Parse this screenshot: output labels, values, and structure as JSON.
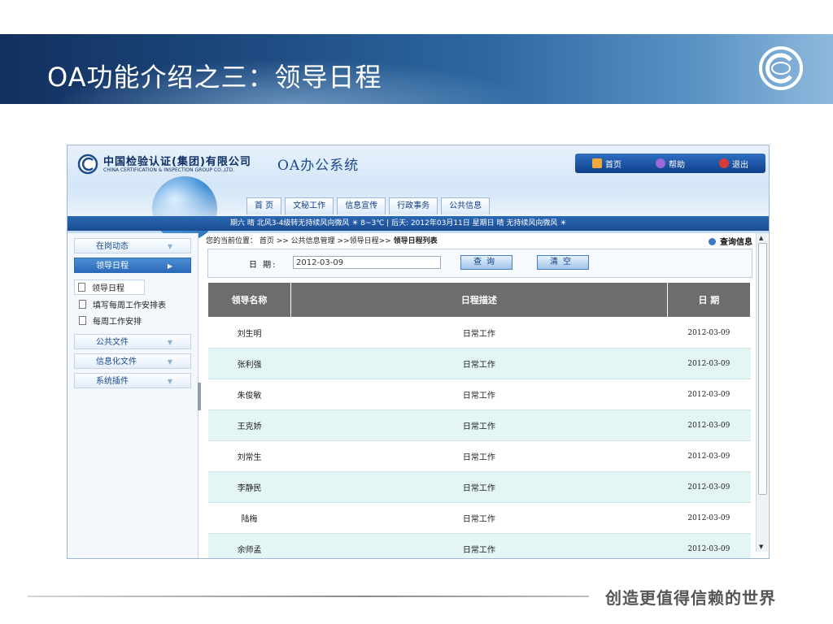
{
  "slide": {
    "title": "OA功能介绍之三：领导日程",
    "slogan": "创造更值得信赖的世界"
  },
  "app": {
    "company_cn": "中国检验认证(集团)有限公司",
    "company_en": "CHINA CERTIFICATION & INSPECTION GROUP CO.,LTD.",
    "system_name": "OA办公系统",
    "topnav": [
      {
        "label": "首页",
        "icon": "home-icon"
      },
      {
        "label": "帮助",
        "icon": "help-icon"
      },
      {
        "label": "退出",
        "icon": "exit-icon"
      }
    ],
    "tabs": [
      "首 页",
      "文秘工作",
      "信息宣传",
      "行政事务",
      "公共信息"
    ],
    "weather": "期六 晴 北风3-4级转无持续风向微风 ☀ 8~3℃ | 后天: 2012年03月11日 星期日 晴 无持续风向微风 ☀"
  },
  "sidebar": {
    "menu": [
      "在岗动态",
      "领导日程",
      "公共文件",
      "信息化文件",
      "系统插件"
    ],
    "active": "领导日程",
    "sub_items": [
      "领导日程",
      "填写每周工作安排表",
      "每周工作安排"
    ]
  },
  "main": {
    "breadcrumb_prefix": "您的当前位置：  首页 >> 公共信息管理 >>领导日程>> ",
    "breadcrumb_current": "领导日程列表",
    "query_link": "查询信息",
    "date_label": "日  期:",
    "date_value": "2012-03-09",
    "query_button": "查询",
    "clear_button": "清空",
    "columns": [
      "领导名称",
      "日程描述",
      "日  期"
    ],
    "rows": [
      {
        "name": "刘生明",
        "desc": "日常工作",
        "date": "2012-03-09"
      },
      {
        "name": "张利强",
        "desc": "日常工作",
        "date": "2012-03-09"
      },
      {
        "name": "朱俊敏",
        "desc": "日常工作",
        "date": "2012-03-09"
      },
      {
        "name": "王克娇",
        "desc": "日常工作",
        "date": "2012-03-09"
      },
      {
        "name": "刘常生",
        "desc": "日常工作",
        "date": "2012-03-09"
      },
      {
        "name": "李静民",
        "desc": "日常工作",
        "date": "2012-03-09"
      },
      {
        "name": "陆梅",
        "desc": "日常工作",
        "date": "2012-03-09"
      },
      {
        "name": "余师孟",
        "desc": "日常工作",
        "date": "2012-03-09"
      }
    ]
  },
  "colors": {
    "banner": "#1d4a80",
    "header_blue": "#1a4c92",
    "table_header": "#6d6d6d",
    "row_alt": "#e3f5f4"
  }
}
